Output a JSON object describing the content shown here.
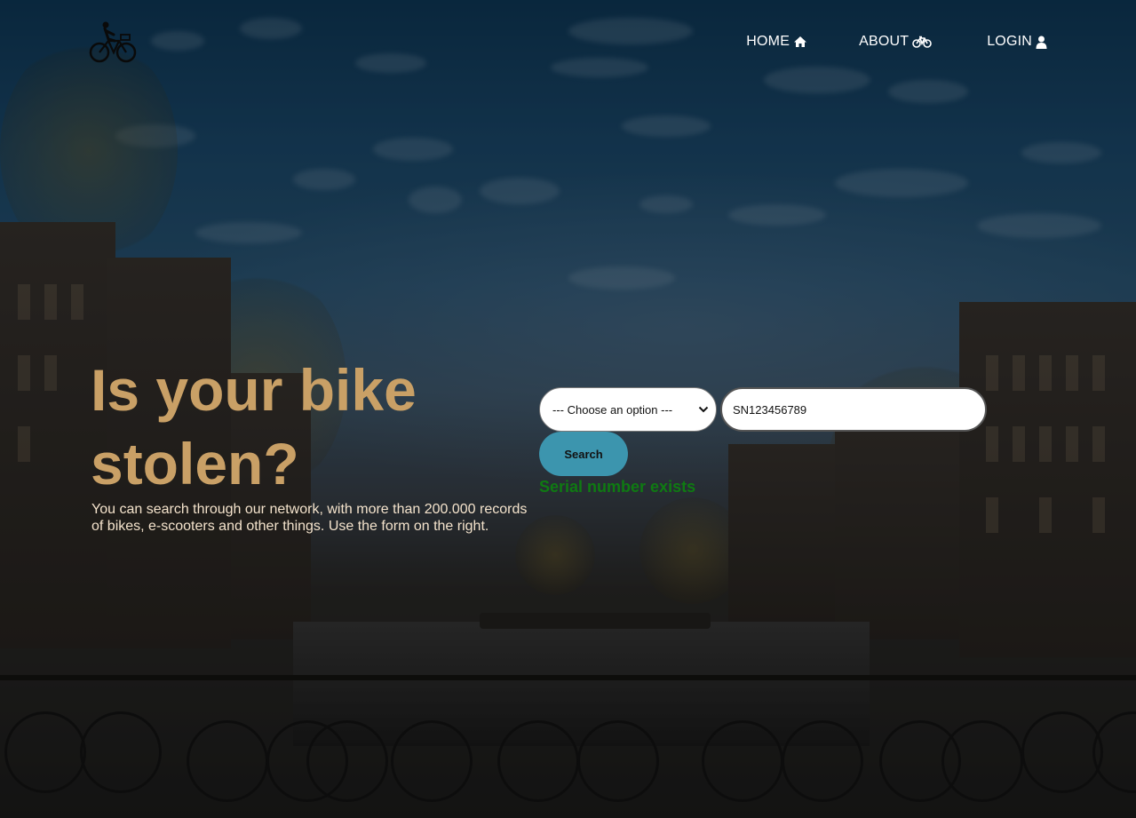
{
  "header": {
    "logo_icon": "bike-rider-icon",
    "nav": [
      {
        "label": "HOME",
        "icon": "home-icon"
      },
      {
        "label": "ABOUT",
        "icon": "bicycle-icon"
      },
      {
        "label": "LOGIN",
        "icon": "user-icon"
      }
    ]
  },
  "hero": {
    "title": "Is your bike stolen?",
    "description": "You can search through our network, with more than 200.000 records of bikes, e-scooters and other things. Use the form on the right."
  },
  "search_form": {
    "select_value": "--- Choose an option ---",
    "serial_value": "SN123456789",
    "search_label": "Search",
    "status_text": "Serial number exists"
  },
  "colors": {
    "title": "#c9a066",
    "button": "#3c95ae",
    "status": "#0f7a12",
    "nav_text": "#ffffff"
  }
}
